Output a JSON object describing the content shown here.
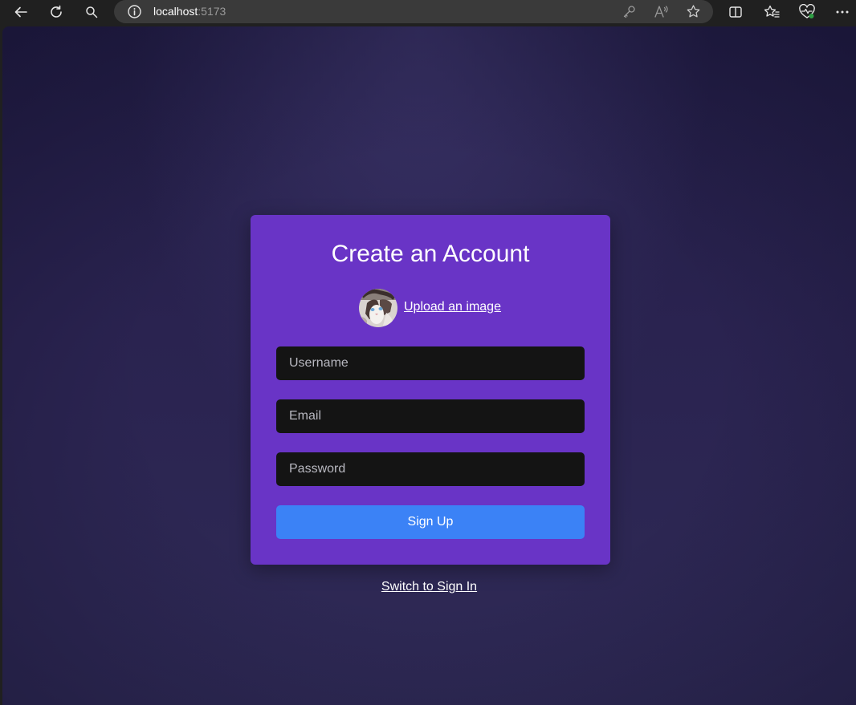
{
  "browser": {
    "address_host": "localhost",
    "address_port": ":5173",
    "nav_icons": [
      "back-icon",
      "refresh-icon",
      "search-icon"
    ],
    "address_icons": [
      "info-icon",
      "key-icon",
      "read-aloud-icon",
      "favorite-star-icon"
    ],
    "toolbar_icons": [
      "split-screen-icon",
      "favorites-icon",
      "browser-essentials-icon",
      "more-icon"
    ]
  },
  "form": {
    "title": "Create an Account",
    "upload_label": "Upload an image",
    "username_placeholder": "Username",
    "email_placeholder": "Email",
    "password_placeholder": "Password",
    "submit_label": "Sign Up"
  },
  "switch_label": "Switch to Sign In",
  "colors": {
    "card": "#6934c6",
    "button": "#3b82f6",
    "input": "#141414",
    "background": "#2a2350"
  }
}
